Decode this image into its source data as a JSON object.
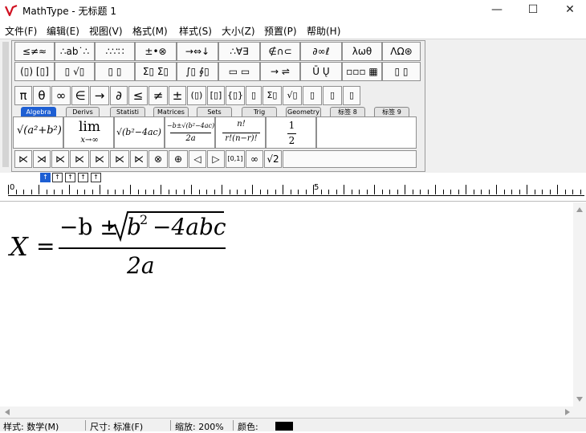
{
  "window": {
    "title": "MathType - 无标题 1",
    "min_icon": "—",
    "max_icon": "☐",
    "close_icon": "✕"
  },
  "menu": {
    "items": [
      "文件(F)",
      "编辑(E)",
      "视图(V)",
      "格式(M)",
      "样式(S)",
      "大小(Z)",
      "预置(P)",
      "帮助(H)"
    ]
  },
  "palette": {
    "row1": [
      "≤≠≈",
      "∴ab˙∴",
      "∴∵∷",
      "±•⊗",
      "→⇔↓",
      "∴∀∃",
      "∉∩⊂",
      "∂∞ℓ",
      "λωθ",
      "ΛΩ⊛"
    ],
    "row2": [
      "(▯) [▯]",
      "▯ √▯",
      "▯ ▯",
      "Σ▯ Σ▯",
      "∫▯ ∮▯",
      "▭ ▭",
      "→ ⇌",
      "Ū Ų",
      "▫▫▫ ▦",
      "▯ ▯"
    ],
    "row3": [
      "π",
      "θ",
      "∞",
      "∈",
      "→",
      "∂",
      "≤",
      "≠",
      "±",
      "(▯)",
      "[▯]",
      "{▯}",
      "▯",
      "Σ▯",
      "√▯",
      "▯",
      "▯",
      "▯"
    ],
    "tabs": [
      "Algebra",
      "Derivs",
      "Statisti",
      "Matrices",
      "Sets",
      "Trig",
      "Geometry",
      "标签 8",
      "标签 9"
    ],
    "row5": [
      "⋉",
      "⋊",
      "⋉",
      "⋉",
      "⋉",
      "⋉",
      "⋉",
      "⊗",
      "⊕",
      "◁",
      "▷",
      "[0,1]",
      "∞",
      "√2"
    ],
    "templates": {
      "t1": "√(a²+b²)",
      "t2_top": "lim",
      "t2_bottom": "x→∞",
      "t3": "√(b²−4ac)",
      "t4_num": "−b±√(b²−4ac)",
      "t4_den": "2a",
      "t5_num": "n!",
      "t5_den": "r!(n−r)!",
      "t6_num": "1",
      "t6_den": "2"
    },
    "insert_icons": [
      "↑",
      "↑",
      "↑",
      "↑",
      "↑"
    ]
  },
  "ruler": {
    "label_0": "0",
    "label_5": "5"
  },
  "equation": {
    "lhs": "X",
    "equals": "=",
    "numerator_prefix": "−b ±",
    "radicand": "b",
    "exponent": "2",
    "radicand_rest": "−4abc",
    "denominator": "2a"
  },
  "statusbar": {
    "style": "样式: 数学(M)",
    "size": "尺寸: 标准(F)",
    "zoom": "缩放: 200%",
    "color_label": "颜色:",
    "color_value": "#000000"
  }
}
